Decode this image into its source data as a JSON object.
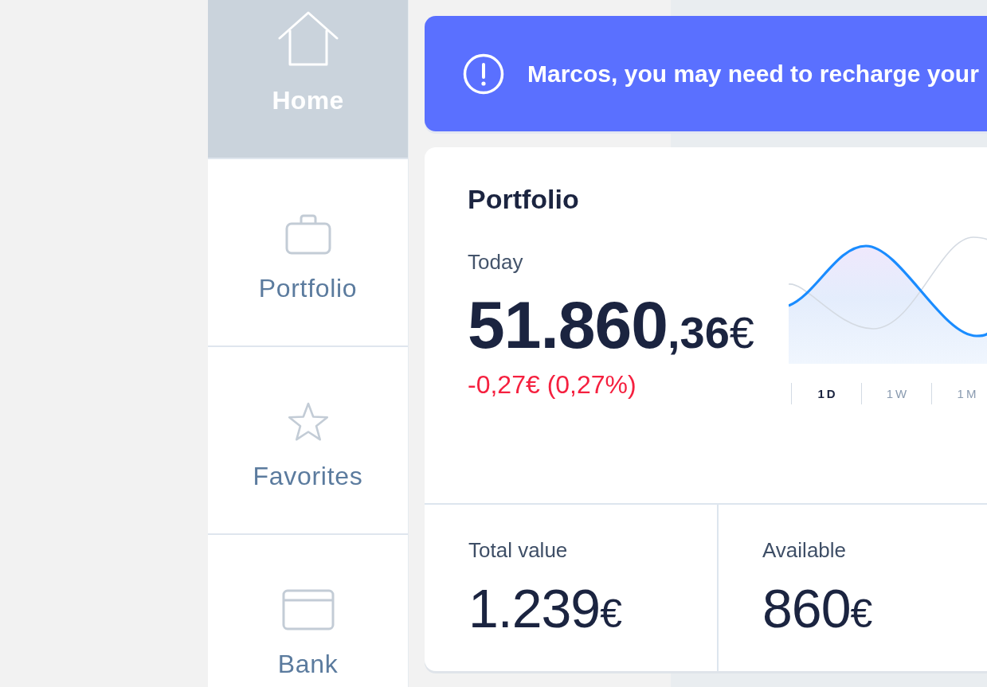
{
  "sidebar": {
    "items": [
      {
        "label": "Home",
        "selected": true
      },
      {
        "label": "Portfolio",
        "selected": false
      },
      {
        "label": "Favorites",
        "selected": false
      },
      {
        "label": "Bank",
        "selected": false
      }
    ]
  },
  "alert_banner": {
    "message": "Marcos, you may need to recharge your"
  },
  "portfolio": {
    "title": "Portfolio",
    "period_label": "Today",
    "value": {
      "main": "51.860",
      "cents": ",36",
      "currency": "€"
    },
    "change": "-0,27€ (0,27%)",
    "periods": [
      {
        "label": "1D",
        "selected": true
      },
      {
        "label": "1W",
        "selected": false
      },
      {
        "label": "1M",
        "selected": false
      }
    ]
  },
  "stats": [
    {
      "label": "Total value",
      "amount": "1.239",
      "currency": "€"
    },
    {
      "label": "Available",
      "amount": "860",
      "currency": "€"
    }
  ]
}
